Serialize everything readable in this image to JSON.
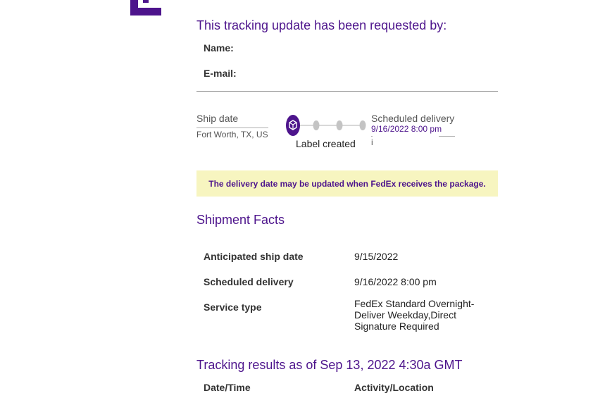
{
  "brand": {
    "accent_color": "#4d148c",
    "logo_icon": "fedex-logo-fragment"
  },
  "request": {
    "title": "This tracking update has been requested by:",
    "name_label": "Name:",
    "email_label": "E-mail:"
  },
  "progress": {
    "ship_date_label": "Ship date",
    "origin": "Fort Worth, TX, US",
    "current_step_label": "Label created",
    "current_step_icon": "package-icon",
    "scheduled_label": "Scheduled delivery",
    "scheduled_value": "9/16/2022 8:00 pm",
    "info_marker": "i",
    "steps_completed": 1,
    "steps_total": 4
  },
  "notice": {
    "text": "The delivery date may be updated when FedEx receives the package.",
    "background_color": "#f7f5c0"
  },
  "shipment_facts": {
    "title": "Shipment Facts",
    "rows": [
      {
        "label": "Anticipated ship date",
        "value": "9/15/2022"
      },
      {
        "label": "Scheduled delivery",
        "value": "9/16/2022 8:00 pm"
      },
      {
        "label": "Service type",
        "value": "FedEx Standard Overnight-Deliver Weekday,Direct Signature Required"
      }
    ]
  },
  "tracking_results": {
    "title": "Tracking results as of Sep 13, 2022 4:30a GMT",
    "columns": [
      "Date/Time",
      "Activity/Location"
    ]
  }
}
